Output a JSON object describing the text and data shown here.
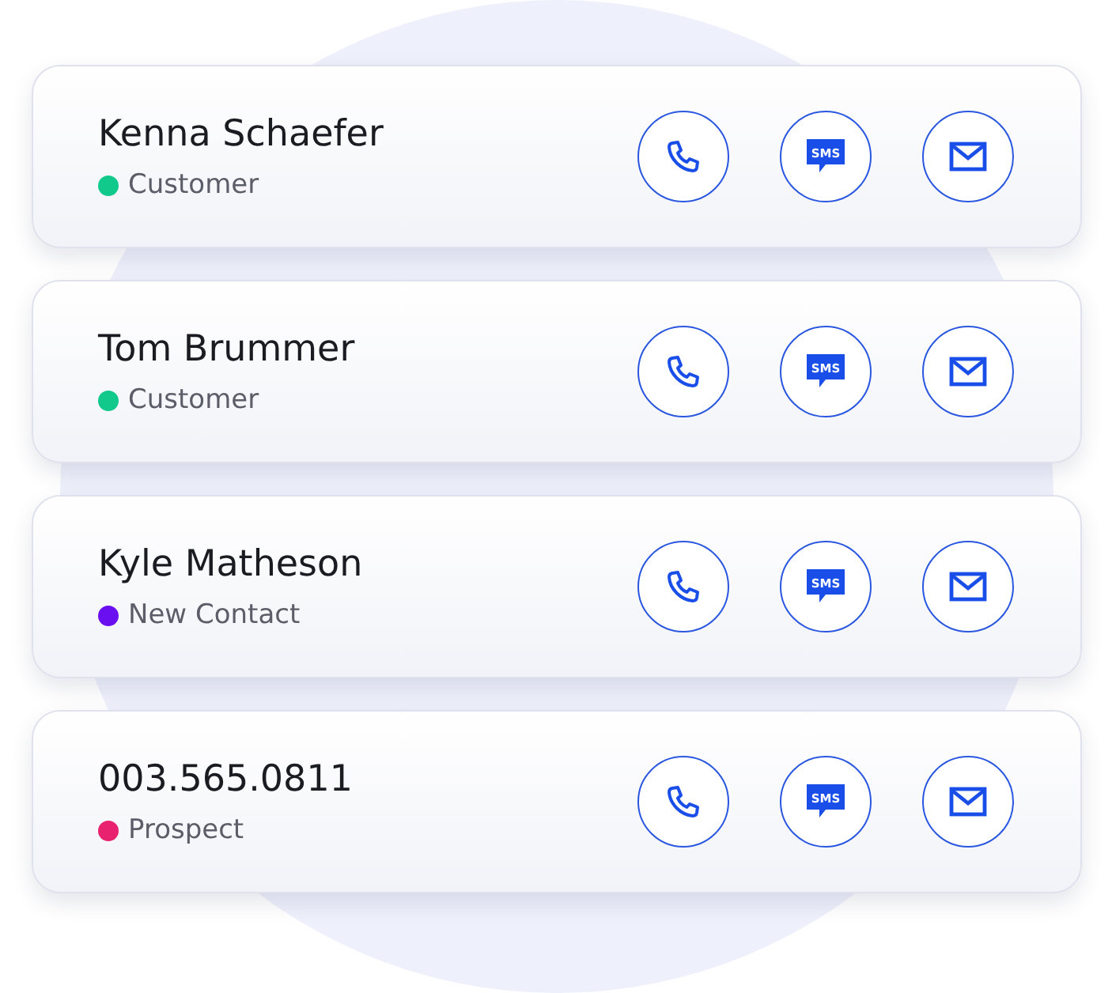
{
  "contacts": [
    {
      "name": "Kenna Schaefer",
      "status": "Customer",
      "color": "#10c98a",
      "actions": [
        {
          "kind": "call"
        },
        {
          "kind": "sms",
          "label": "SMS"
        },
        {
          "kind": "email"
        }
      ]
    },
    {
      "name": "Tom Brummer",
      "status": "Customer",
      "color": "#10c98a",
      "actions": [
        {
          "kind": "call"
        },
        {
          "kind": "sms",
          "label": "SMS"
        },
        {
          "kind": "email"
        }
      ]
    },
    {
      "name": "Kyle Matheson",
      "status": "New Contact",
      "color": "#6a0ff0",
      "actions": [
        {
          "kind": "call"
        },
        {
          "kind": "sms",
          "label": "SMS"
        },
        {
          "kind": "email"
        }
      ]
    },
    {
      "name": "003.565.0811",
      "status": "Prospect",
      "color": "#e8226e",
      "actions": [
        {
          "kind": "call"
        },
        {
          "kind": "sms",
          "label": "SMS"
        },
        {
          "kind": "email"
        }
      ]
    }
  ]
}
